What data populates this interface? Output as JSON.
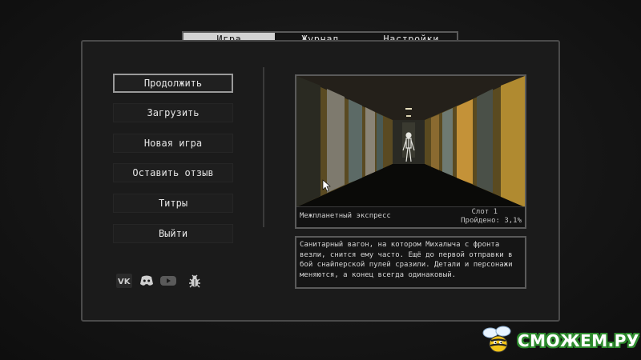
{
  "tabs": [
    {
      "label": "Игра",
      "active": true
    },
    {
      "label": "Журнал",
      "active": false
    },
    {
      "label": "Настройки",
      "active": false
    }
  ],
  "menu": [
    {
      "label": "Продолжить",
      "selected": true
    },
    {
      "label": "Загрузить",
      "selected": false
    },
    {
      "label": "Новая игра",
      "selected": false
    },
    {
      "label": "Оставить отзыв",
      "selected": false
    },
    {
      "label": "Титры",
      "selected": false
    },
    {
      "label": "Выйти",
      "selected": false
    }
  ],
  "social_icons": [
    "vk-icon",
    "discord-icon",
    "youtube-icon",
    "bug-icon"
  ],
  "save": {
    "title": "Межпланетный экспресс",
    "slot": "Слот 1",
    "progress": "Пройдено: 3,1%",
    "description": "Санитарный вагон, на котором Михалыча с фронта везли, снится ему часто. Ещё до первой отправки в бой снайперской пулей сразили. Детали и персонажи меняются, а конец всегда одинаковый."
  },
  "watermark": {
    "text": "СМОЖЕМ.РУ"
  },
  "colors": {
    "background": "#1b1b1b",
    "frame_border": "#4a4a4a",
    "active_tab": "#d2d2d2",
    "text": "#e0e0e0",
    "watermark_green": "#2e8b2e"
  }
}
